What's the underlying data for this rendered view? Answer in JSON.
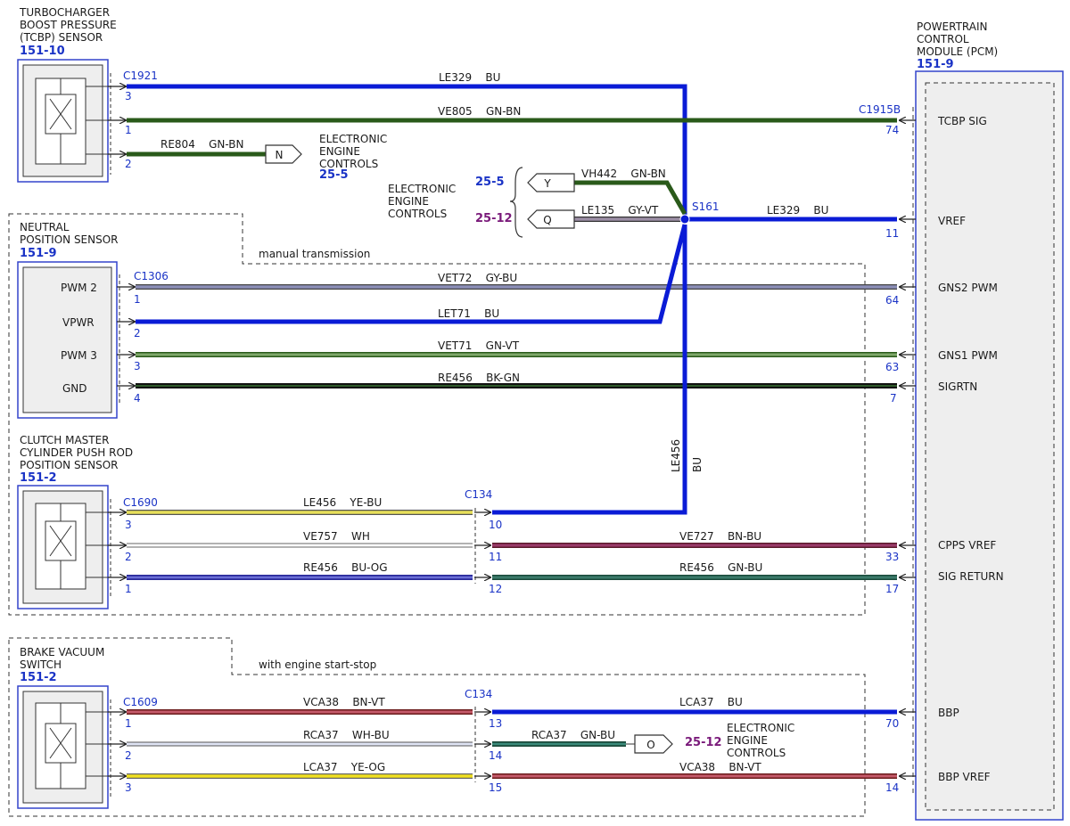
{
  "components": {
    "tcbp": {
      "name1": "TURBOCHARGER",
      "name2": "BOOST PRESSURE",
      "name3": "(TCBP) SENSOR",
      "ref": "151-10",
      "connector": "C1921"
    },
    "nps": {
      "name1": "NEUTRAL",
      "name2": "POSITION SENSOR",
      "ref": "151-9",
      "connector": "C1306",
      "pins": [
        "PWM 2",
        "VPWR",
        "PWM 3",
        "GND"
      ]
    },
    "cmc": {
      "name1": "CLUTCH MASTER",
      "name2": "CYLINDER PUSH ROD",
      "name3": "POSITION SENSOR",
      "ref": "151-2",
      "connector": "C1690"
    },
    "bvs": {
      "name1": "BRAKE VACUUM",
      "name2": "SWITCH",
      "ref": "151-2",
      "connector": "C1609"
    },
    "pcm": {
      "name1": "POWERTRAIN",
      "name2": "CONTROL",
      "name3": "MODULE (PCM)",
      "ref": "151-9",
      "connector": "C1915B",
      "pins": [
        "TCBP SIG",
        "VREF",
        "GNS2 PWM",
        "GNS1 PWM",
        "SIGRTN",
        "CPPS VREF",
        "SIG RETURN",
        "BBP",
        "BBP VREF"
      ]
    }
  },
  "inline": {
    "c134_top": "C134",
    "c134_bottom": "C134",
    "splice": "S161"
  },
  "options": {
    "manual": "manual transmission",
    "startstop": "with engine start-stop"
  },
  "eec": {
    "line1": "ELECTRONIC",
    "line2": "ENGINE",
    "line3": "CONTROLS",
    "ref1": "25-5",
    "ref2": "25-5",
    "ref3": "25-12",
    "ref4": "25-12"
  },
  "flags": {
    "n": "N",
    "y": "Y",
    "q": "Q",
    "o": "O"
  },
  "wires": [
    {
      "label": "LE329    BU",
      "pin": "3"
    },
    {
      "label": "VE805    GN-BN",
      "pin": "1",
      "pcm_pin": "74"
    },
    {
      "label": "RE804    GN-BN",
      "pin": "2"
    },
    {
      "label": "VH442    GN-BN"
    },
    {
      "label": "LE135    GY-VT"
    },
    {
      "label": "LE329    BU",
      "pcm_pin": "11"
    },
    {
      "label": "VET72    GY-BU",
      "pin": "1",
      "pcm_pin": "64"
    },
    {
      "label": "LET71    BU",
      "pin": "2"
    },
    {
      "label": "VET71    GN-VT",
      "pin": "3",
      "pcm_pin": "63"
    },
    {
      "label": "RE456    BK-GN",
      "pin": "4",
      "pcm_pin": "7"
    },
    {
      "label": "LE456    YE-BU",
      "pin": "3",
      "c134": "10"
    },
    {
      "label": "VE757    WH",
      "pin": "2",
      "c134": "11"
    },
    {
      "label": "RE456    BU-OG",
      "pin": "1",
      "c134": "12"
    },
    {
      "label": "VE727    BN-BU",
      "pcm_pin": "33"
    },
    {
      "label": "RE456    GN-BU",
      "pcm_pin": "17"
    },
    {
      "label": "VCA38    BN-VT",
      "pin": "1",
      "c134": "13"
    },
    {
      "label": "RCA37    WH-BU",
      "pin": "2",
      "c134": "14"
    },
    {
      "label": "LCA37    YE-OG",
      "pin": "3",
      "c134": "15"
    },
    {
      "label": "LCA37    BU",
      "pcm_pin": "70"
    },
    {
      "label": "RCA37    GN-BU"
    },
    {
      "label": "VCA38    BN-VT",
      "pcm_pin": "14"
    }
  ],
  "vertical_wire": {
    "circuit": "LE456",
    "color": "BU"
  }
}
